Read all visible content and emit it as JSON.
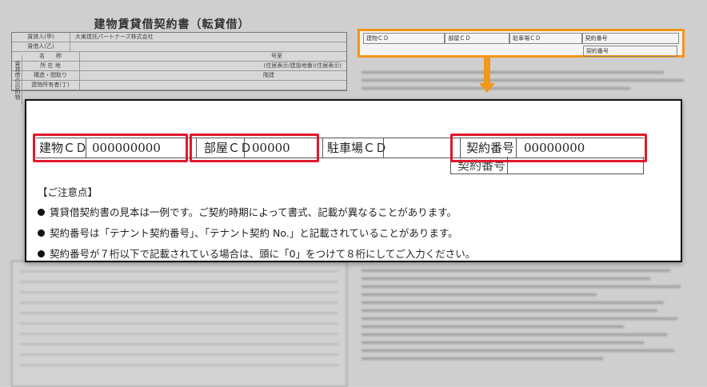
{
  "document": {
    "title": "建物賃貸借契約書（転貸借）",
    "left_table_rows": [
      {
        "head": "賃貸人(甲)",
        "value": "大東建託パートナーズ株式会社"
      },
      {
        "head": "賃借人(乙)",
        "value": ""
      },
      {
        "head": "名　　称",
        "value": "号室"
      },
      {
        "head": "所 在 地",
        "value": "(住居表示/建設地番)(住居表示)"
      },
      {
        "head": "構造・間取り",
        "value": "階建"
      },
      {
        "head": "建物所有者(丁)",
        "value": ""
      }
    ],
    "left_side_label": "賃貸借の目的物"
  },
  "small_form": {
    "row1": [
      "建物ＣＤ",
      "部屋ＣＤ",
      "駐車場ＣＤ",
      "契約番号"
    ],
    "row2": [
      "契約番号"
    ]
  },
  "callout": {
    "building_cd_label": "建物ＣＤ",
    "building_cd_value": "000000000",
    "room_cd_label": "部屋ＣＤ",
    "room_cd_value": "00000",
    "parking_cd_label": "駐車場ＣＤ",
    "contract_no_label": "契約番号",
    "contract_no_value": "00000000",
    "contract_no_label_2": "契約番号",
    "notes_title": "【ご注意点】",
    "notes": [
      "賃貸借契約書の見本は一例です。ご契約時期によって書式、記載が異なることがあります。",
      "契約番号は「テナント契約番号」、「テナント契約 No.」と記載されていることがあります。",
      "契約番号が７桁以下で記載されている場合は、頭に「0」をつけて８桁にしてご入力ください。"
    ]
  },
  "colors": {
    "highlight_orange": "#f3961c",
    "highlight_red": "#e0182d"
  }
}
